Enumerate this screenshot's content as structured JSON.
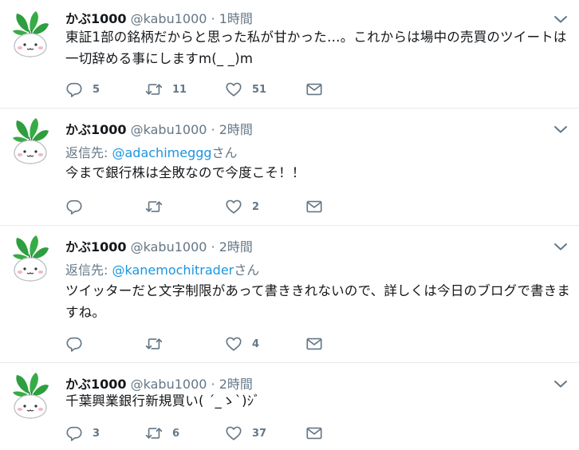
{
  "tweets": [
    {
      "name": "かぶ1000",
      "handle": "@kabu1000",
      "dot": "·",
      "time": "1時間",
      "reply_prefix": "",
      "reply_mention": "",
      "reply_suffix": "",
      "text": "東証1部の銘柄だからと思った私が甘かった…。これからは場中の売買のツイートは一切辞める事にしますm(_ _)m",
      "replies": "5",
      "retweets": "11",
      "likes": "51"
    },
    {
      "name": "かぶ1000",
      "handle": "@kabu1000",
      "dot": "·",
      "time": "2時間",
      "reply_prefix": "返信先: ",
      "reply_mention": "@adachimeggg",
      "reply_suffix": "さん",
      "text": "今まで銀行株は全敗なので今度こそ！！",
      "replies": "",
      "retweets": "",
      "likes": "2"
    },
    {
      "name": "かぶ1000",
      "handle": "@kabu1000",
      "dot": "·",
      "time": "2時間",
      "reply_prefix": "返信先: ",
      "reply_mention": "@kanemochitrader",
      "reply_suffix": "さん",
      "text": "ツイッターだと文字制限があって書ききれないので、詳しくは今日のブログで書きますね。",
      "replies": "",
      "retweets": "",
      "likes": "4"
    },
    {
      "name": "かぶ1000",
      "handle": "@kabu1000",
      "dot": "·",
      "time": "2時間",
      "reply_prefix": "",
      "reply_mention": "",
      "reply_suffix": "",
      "text": "千葉興業銀行新規買い( ´_ゝ`)ｼﾞ",
      "replies": "3",
      "retweets": "6",
      "likes": "37"
    }
  ],
  "icons": [
    "avatar-turnip",
    "reply-icon",
    "retweet-icon",
    "like-icon",
    "dm-icon",
    "chevron-down-icon"
  ],
  "colors": {
    "text": "#14171a",
    "muted": "#657786",
    "link": "#1b95e0",
    "divider": "#e6ecf0",
    "turnip_leaf": "#2e9e3f"
  }
}
